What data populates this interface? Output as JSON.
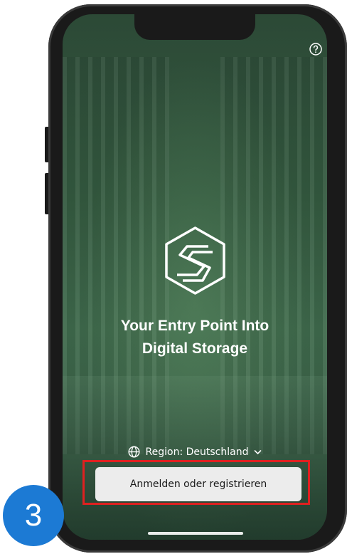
{
  "screen": {
    "title": "Your Entry Point Into\nDigital Storage",
    "region_label": "Region: Deutschland",
    "login_button": "Anmelden oder registrieren"
  },
  "annotation": {
    "step_number": "3",
    "highlight_color": "#e02020",
    "badge_color": "#1c7ad4"
  },
  "icons": {
    "help": "help-circle-icon",
    "globe": "globe-icon",
    "chevron": "chevron-down-icon",
    "logo": "hexagon-s-logo"
  }
}
